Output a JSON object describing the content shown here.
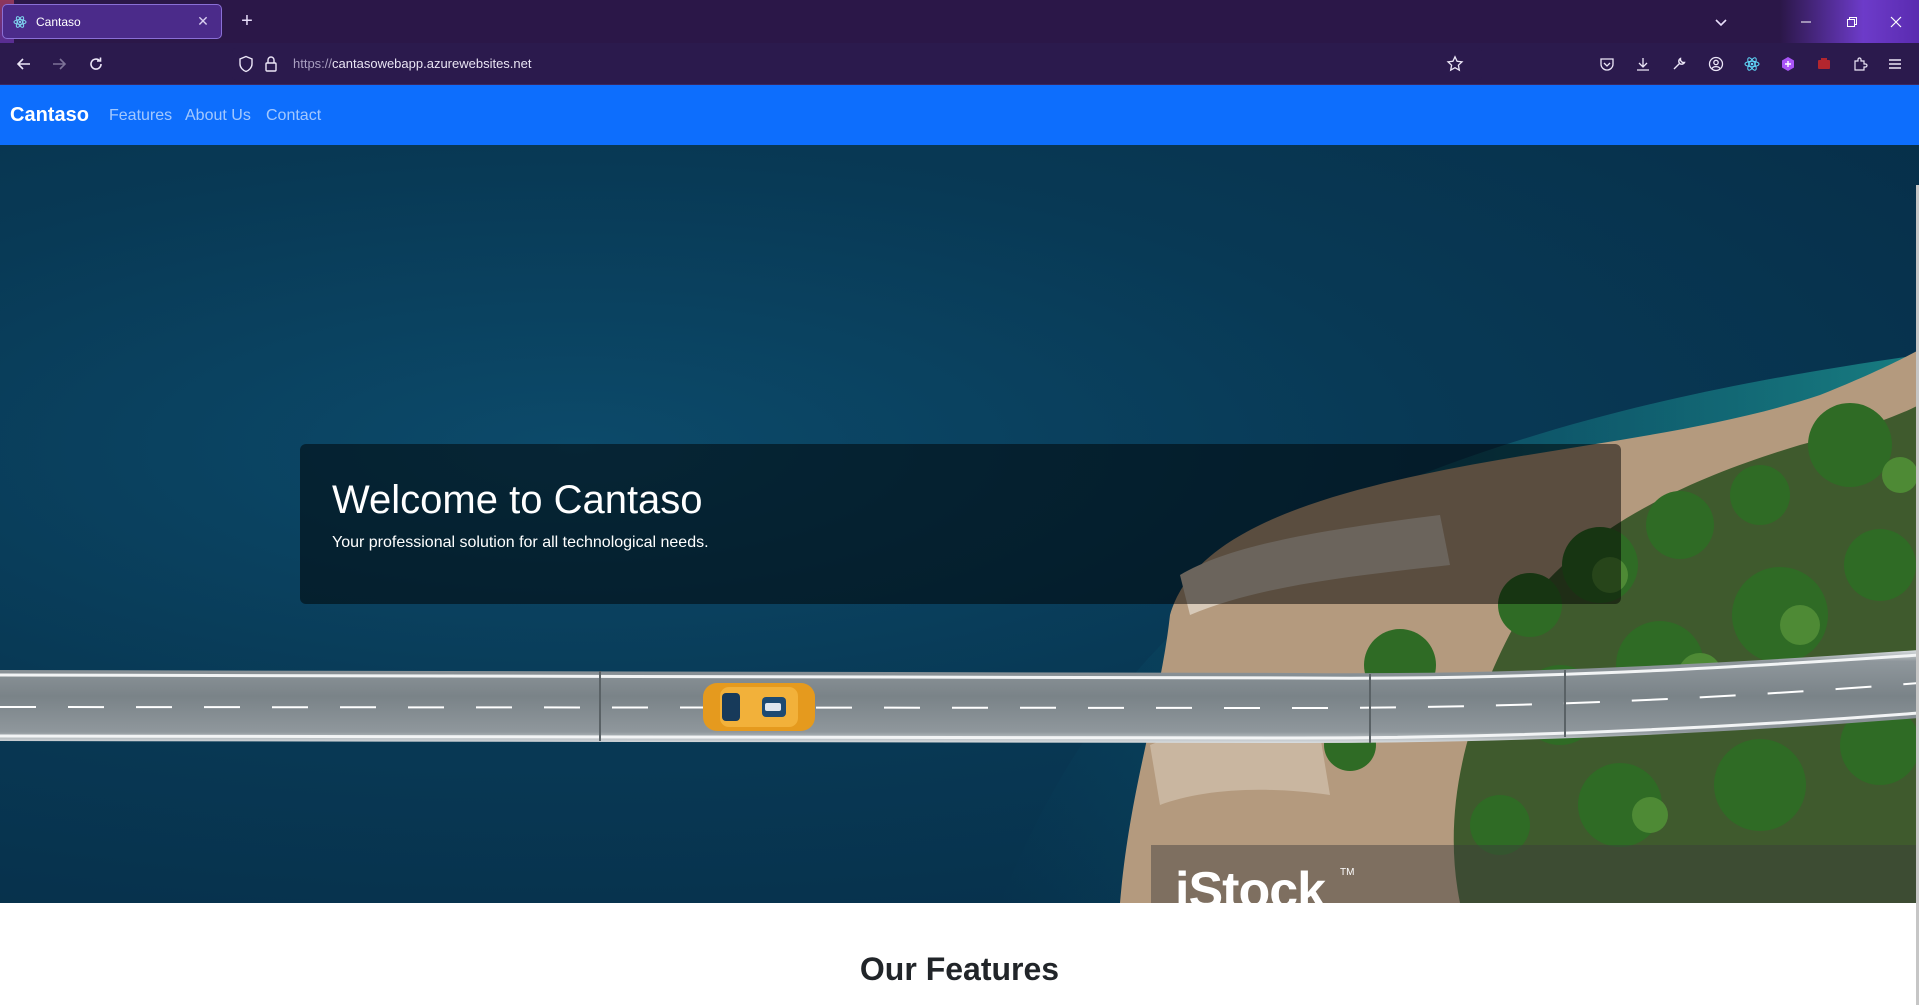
{
  "browser": {
    "tab_title": "Cantaso",
    "url_protocol": "https://",
    "url_host": "cantasowebapp.azurewebsites.net",
    "accent": "#0d6efd"
  },
  "site": {
    "brand": "Cantaso",
    "nav": [
      "Features",
      "About Us",
      "Contact"
    ]
  },
  "hero": {
    "title": "Welcome to Cantaso",
    "subtitle": "Your professional solution for all technological needs.",
    "watermark": "iStock",
    "watermark_tm": "TM"
  },
  "features": {
    "heading": "Our Features"
  }
}
